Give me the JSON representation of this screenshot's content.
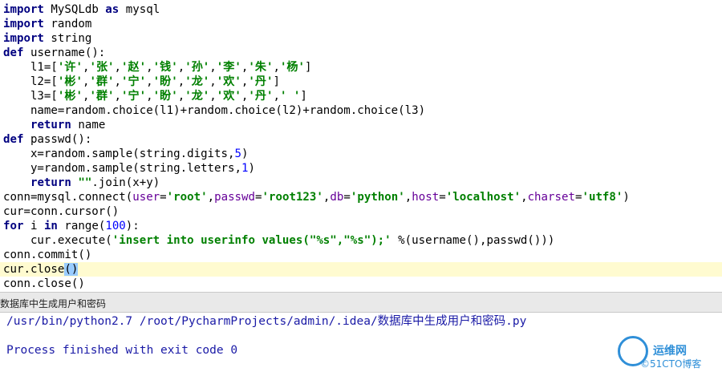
{
  "code_lines": [
    [
      {
        "t": "import",
        "c": "kw"
      },
      {
        "t": " MySQLdb "
      },
      {
        "t": "as",
        "c": "kw"
      },
      {
        "t": " mysql"
      }
    ],
    [
      {
        "t": "import",
        "c": "kw"
      },
      {
        "t": " random"
      }
    ],
    [
      {
        "t": "import",
        "c": "kw"
      },
      {
        "t": " string"
      }
    ],
    [
      {
        "t": "def",
        "c": "kw"
      },
      {
        "t": " username():"
      }
    ],
    [
      {
        "t": "    l1=["
      },
      {
        "t": "'许'",
        "c": "str"
      },
      {
        "t": ","
      },
      {
        "t": "'张'",
        "c": "str"
      },
      {
        "t": ","
      },
      {
        "t": "'赵'",
        "c": "str"
      },
      {
        "t": ","
      },
      {
        "t": "'钱'",
        "c": "str"
      },
      {
        "t": ","
      },
      {
        "t": "'孙'",
        "c": "str"
      },
      {
        "t": ","
      },
      {
        "t": "'李'",
        "c": "str"
      },
      {
        "t": ","
      },
      {
        "t": "'朱'",
        "c": "str"
      },
      {
        "t": ","
      },
      {
        "t": "'杨'",
        "c": "str"
      },
      {
        "t": "]"
      }
    ],
    [
      {
        "t": "    l2=["
      },
      {
        "t": "'彬'",
        "c": "str"
      },
      {
        "t": ","
      },
      {
        "t": "'群'",
        "c": "str"
      },
      {
        "t": ","
      },
      {
        "t": "'宁'",
        "c": "str"
      },
      {
        "t": ","
      },
      {
        "t": "'盼'",
        "c": "str"
      },
      {
        "t": ","
      },
      {
        "t": "'龙'",
        "c": "str"
      },
      {
        "t": ","
      },
      {
        "t": "'欢'",
        "c": "str"
      },
      {
        "t": ","
      },
      {
        "t": "'丹'",
        "c": "str"
      },
      {
        "t": "]"
      }
    ],
    [
      {
        "t": "    l3=["
      },
      {
        "t": "'彬'",
        "c": "str"
      },
      {
        "t": ","
      },
      {
        "t": "'群'",
        "c": "str"
      },
      {
        "t": ","
      },
      {
        "t": "'宁'",
        "c": "str"
      },
      {
        "t": ","
      },
      {
        "t": "'盼'",
        "c": "str"
      },
      {
        "t": ","
      },
      {
        "t": "'龙'",
        "c": "str"
      },
      {
        "t": ","
      },
      {
        "t": "'欢'",
        "c": "str"
      },
      {
        "t": ","
      },
      {
        "t": "'丹'",
        "c": "str"
      },
      {
        "t": ","
      },
      {
        "t": "' '",
        "c": "str"
      },
      {
        "t": "]"
      }
    ],
    [
      {
        "t": "    name=random.choice(l1)+random.choice(l2)+random.choice(l3)"
      }
    ],
    [
      {
        "t": "    "
      },
      {
        "t": "return",
        "c": "kw"
      },
      {
        "t": " name"
      }
    ],
    [
      {
        "t": "def",
        "c": "kw"
      },
      {
        "t": " passwd():"
      }
    ],
    [
      {
        "t": "    x=random.sample(string.digits,"
      },
      {
        "t": "5",
        "c": "num"
      },
      {
        "t": ")"
      }
    ],
    [
      {
        "t": "    y=random.sample(string.letters,"
      },
      {
        "t": "1",
        "c": "num"
      },
      {
        "t": ")"
      }
    ],
    [
      {
        "t": "    "
      },
      {
        "t": "return",
        "c": "kw"
      },
      {
        "t": " "
      },
      {
        "t": "\"\"",
        "c": "str"
      },
      {
        "t": ".join(x+y)"
      }
    ],
    [
      {
        "t": "conn=mysql.connect("
      },
      {
        "t": "user",
        "c": "param"
      },
      {
        "t": "="
      },
      {
        "t": "'root'",
        "c": "str"
      },
      {
        "t": ","
      },
      {
        "t": "passwd",
        "c": "param"
      },
      {
        "t": "="
      },
      {
        "t": "'root123'",
        "c": "str"
      },
      {
        "t": ","
      },
      {
        "t": "db",
        "c": "param"
      },
      {
        "t": "="
      },
      {
        "t": "'python'",
        "c": "str"
      },
      {
        "t": ","
      },
      {
        "t": "host",
        "c": "param"
      },
      {
        "t": "="
      },
      {
        "t": "'localhost'",
        "c": "str"
      },
      {
        "t": ","
      },
      {
        "t": "charset",
        "c": "param"
      },
      {
        "t": "="
      },
      {
        "t": "'utf8'",
        "c": "str"
      },
      {
        "t": ")"
      }
    ],
    [
      {
        "t": "cur=conn.cursor()"
      }
    ],
    [
      {
        "t": "for",
        "c": "kw"
      },
      {
        "t": " i "
      },
      {
        "t": "in",
        "c": "kw"
      },
      {
        "t": " range("
      },
      {
        "t": "100",
        "c": "num"
      },
      {
        "t": "):"
      }
    ],
    [
      {
        "t": "    cur.execute("
      },
      {
        "t": "'insert into userinfo values(\"%s\",\"%s\");'",
        "c": "str"
      },
      {
        "t": " %(username(),passwd()))"
      }
    ],
    [
      {
        "t": "conn.commit()"
      }
    ],
    [
      {
        "t": "cur.close"
      },
      {
        "t": "()",
        "c": "brace"
      }
    ],
    [
      {
        "t": "conn.close()"
      }
    ]
  ],
  "highlighted_line": 18,
  "run_tab": {
    "label": "数据库中生成用户和密码"
  },
  "console": {
    "command": "/usr/bin/python2.7 /root/PycharmProjects/admin/.idea/数据库中生成用户和密码.py",
    "exit_message": "Process finished with exit code 0"
  },
  "watermark": {
    "top": "运维网",
    "bottom": "©51CTO博客"
  }
}
